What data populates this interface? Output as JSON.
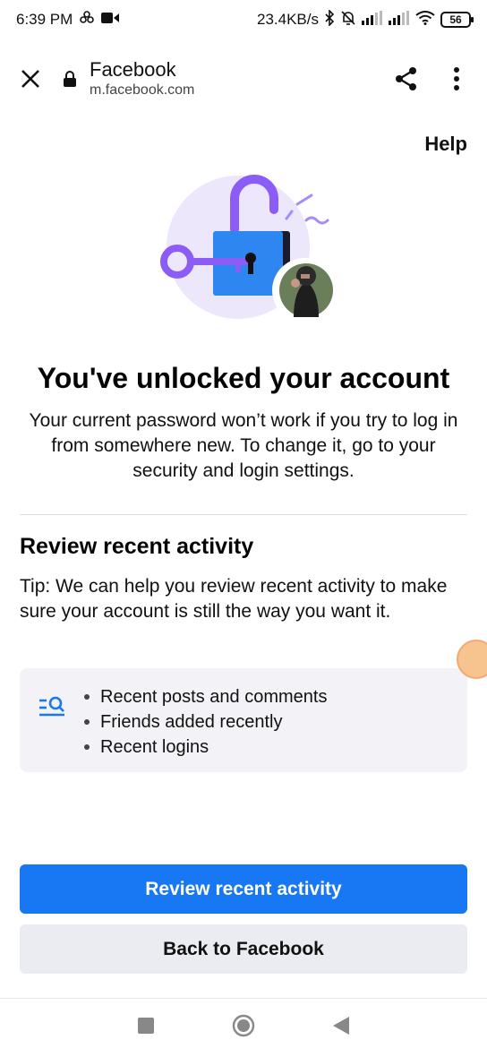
{
  "status_bar": {
    "time": "6:39 PM",
    "network_speed": "23.4KB/s",
    "battery_level": "56",
    "icons": [
      "flower-icon",
      "video-camera-icon",
      "bluetooth-icon",
      "mute-icon",
      "signal-icon",
      "signal-icon",
      "wifi-icon",
      "battery-icon"
    ]
  },
  "browser": {
    "site_title": "Facebook",
    "url": "m.facebook.com",
    "icons": [
      "close-icon",
      "lock-icon",
      "share-icon",
      "more-vertical-icon"
    ]
  },
  "page": {
    "help_label": "Help",
    "headline": "You've unlocked your account",
    "subtext": "Your current password won’t work if you try to log in from somewhere new. To change it, go to your security and login settings.",
    "section_title": "Review recent activity",
    "tip": "Tip: We can help you review recent activity to make sure your account is still the way you want it.",
    "activity_items": [
      "Recent posts and comments",
      "Friends added recently",
      "Recent logins"
    ],
    "primary_button": "Review recent activity",
    "secondary_button": "Back to Facebook"
  },
  "colors": {
    "brand_blue": "#1877f2",
    "illustration_purple": "#8b5cf6",
    "card_background": "#f3f2f6"
  },
  "nav_bar": {
    "icons": [
      "recents-square-icon",
      "home-circle-icon",
      "back-triangle-icon"
    ]
  }
}
